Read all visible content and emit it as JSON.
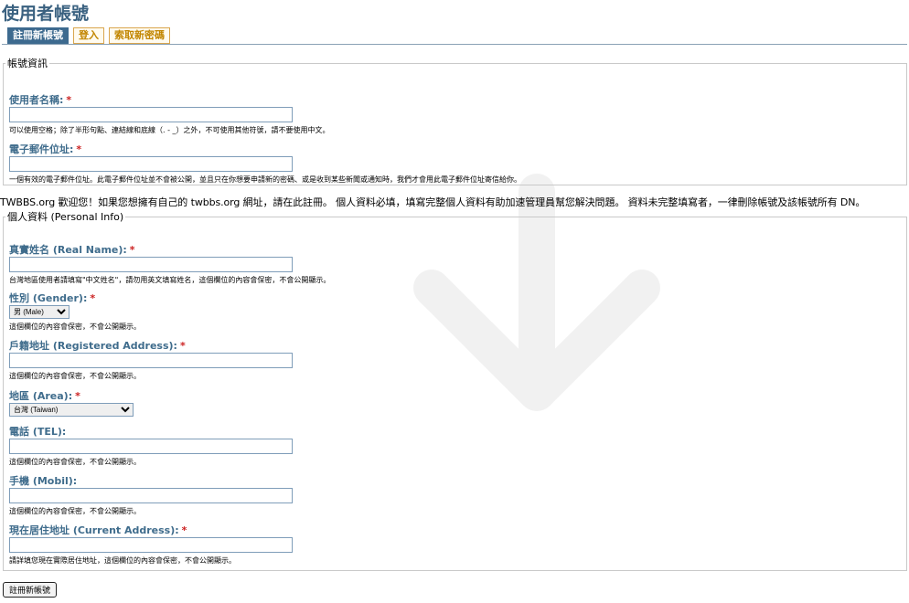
{
  "page": {
    "title": "使用者帳號"
  },
  "tabs": [
    {
      "label": "註冊新帳號",
      "active": true
    },
    {
      "label": "登入",
      "active": false
    },
    {
      "label": "索取新密碼",
      "active": false
    }
  ],
  "account": {
    "legend": "帳號資訊",
    "username": {
      "label": "使用者名稱:",
      "required_mark": "*",
      "value": "",
      "description": "可以使用空格；除了半形句點、連結線和底線（. - _）之外，不可使用其他符號，請不要使用中文。"
    },
    "email": {
      "label": "電子郵件位址:",
      "required_mark": "*",
      "value": "",
      "description": "一個有效的電子郵件位址。此電子郵件位址並不會被公開，並且只在你想要申請新的密碼、或是收到某些新聞或通知時，我們才會用此電子郵件位址寄信給你。"
    }
  },
  "notice": "TWBBS.org 歡迎您！如果您想擁有自己的 twbbs.org 網址，請在此註冊。 個人資料必填，填寫完整個人資料有助加速管理員幫您解決問題。 資料未完整填寫者，一律刪除帳號及該帳號所有 DN。",
  "personal": {
    "legend": "個人資料 (Personal Info)",
    "real_name": {
      "label": "真實姓名 (Real Name):",
      "required_mark": "*",
      "value": "",
      "description": "台灣地區使用者請填寫\"中文姓名\"，請勿用英文填寫姓名，這個欄位的內容會保密，不會公開顯示。"
    },
    "gender": {
      "label": "性別 (Gender):",
      "required_mark": "*",
      "selected": "男 (Male)",
      "description": "這個欄位的內容會保密，不會公開顯示。"
    },
    "registered_address": {
      "label": "戶籍地址 (Registered Address):",
      "required_mark": "*",
      "value": "",
      "description": "這個欄位的內容會保密，不會公開顯示。"
    },
    "area": {
      "label": "地區 (Area):",
      "required_mark": "*",
      "selected": "台灣 (Taiwan)"
    },
    "tel": {
      "label": "電話 (TEL):",
      "value": "",
      "description": "這個欄位的內容會保密，不會公開顯示。"
    },
    "mobile": {
      "label": "手機 (Mobil):",
      "value": "",
      "description": "這個欄位的內容會保密，不會公開顯示。"
    },
    "current_address": {
      "label": "現在居住地址 (Current Address):",
      "required_mark": "*",
      "value": "",
      "description": "請詳填您現在實際居住地址，這個欄位的內容會保密，不會公開顯示。"
    }
  },
  "submit": {
    "label": "註冊新帳號"
  },
  "colors": {
    "title": "#3a6180",
    "label": "#3f6c8c",
    "required": "#cc2222",
    "tab_active_bg": "#3d6a8f",
    "tab_inactive_text": "#c28600"
  },
  "icons": {
    "watermark": "down-arrow-icon"
  }
}
